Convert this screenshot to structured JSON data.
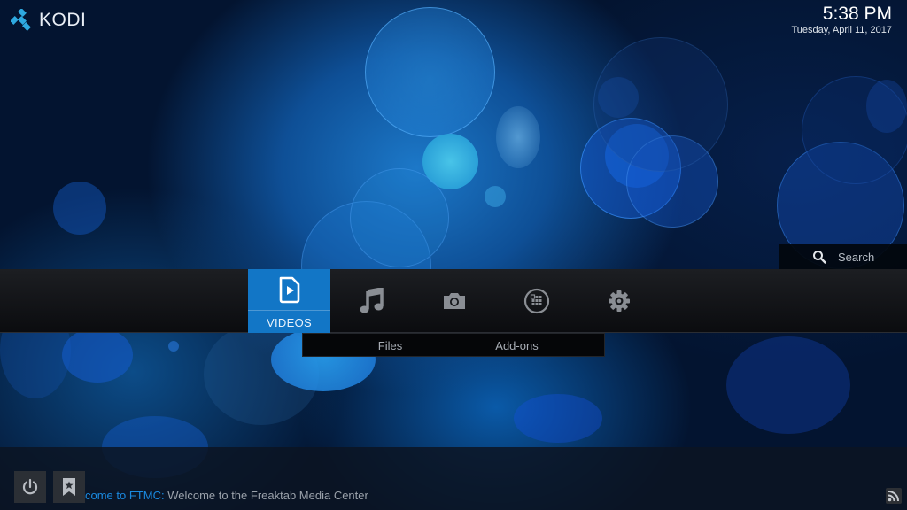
{
  "app": {
    "name": "KODI"
  },
  "clock": {
    "time": "5:38 PM",
    "date": "Tuesday, April 11, 2017"
  },
  "search": {
    "label": "Search",
    "icon": "search-icon"
  },
  "main_menu": {
    "items": [
      {
        "id": "videos",
        "label": "VIDEOS",
        "icon": "video-file-icon",
        "active": true
      },
      {
        "id": "music",
        "label": "",
        "icon": "music-note-icon",
        "active": false
      },
      {
        "id": "pictures",
        "label": "",
        "icon": "camera-icon",
        "active": false
      },
      {
        "id": "addons",
        "label": "",
        "icon": "addons-grid-icon",
        "active": false
      },
      {
        "id": "settings",
        "label": "",
        "icon": "gear-icon",
        "active": false
      }
    ]
  },
  "submenu": {
    "items": [
      {
        "label": "Files"
      },
      {
        "label": "Add-ons"
      }
    ]
  },
  "bottom": {
    "power_icon": "power-icon",
    "favourites_icon": "bookmark-star-icon",
    "ticker_title": "come to FTMC:",
    "ticker_text": " Welcome to the Freaktab Media Center",
    "rss_icon": "rss-icon"
  },
  "colors": {
    "accent": "#1276c6",
    "ticker_title": "#1a8ae0",
    "menu_bg": "#15171b",
    "icon_gray": "#8a8e94"
  }
}
